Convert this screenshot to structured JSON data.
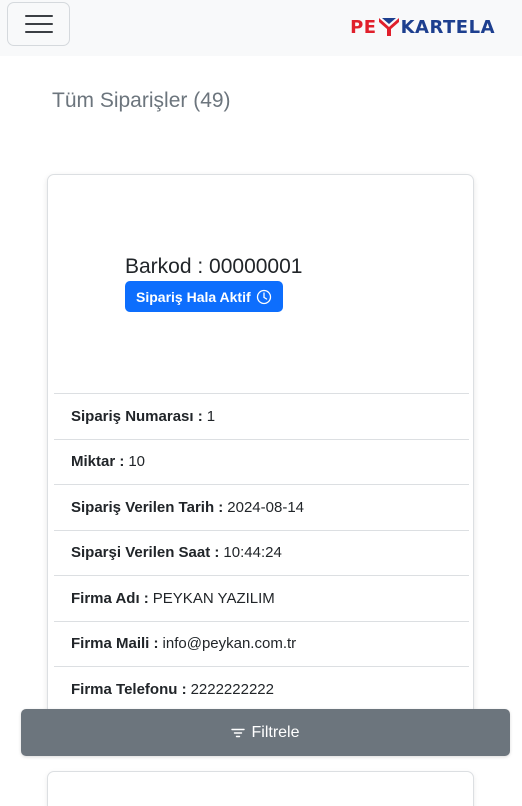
{
  "navbar": {
    "menu_icon": "hamburger-menu-icon",
    "logo_text_left": "PE",
    "logo_text_right": "KARTELA",
    "logo_colors": {
      "red": "#e01f2b",
      "blue": "#1d3f8f"
    }
  },
  "page": {
    "title": "Tüm Siparişler (49)"
  },
  "order_card": {
    "barcode_text": "Barkod : 00000001",
    "status_label": "Sipariş Hala Aktif",
    "status_icon": "clock-icon",
    "status_color": "#0d6efd",
    "fields": [
      {
        "label": "Sipariş Numarası :",
        "value": "1"
      },
      {
        "label": "Miktar :",
        "value": "10"
      },
      {
        "label": "Sipariş Verilen Tarih :",
        "value": "2024-08-14"
      },
      {
        "label": "Siparşi Verilen Saat :",
        "value": "10:44:24"
      },
      {
        "label": "Firma Adı :",
        "value": "PEYKAN YAZILIM"
      },
      {
        "label": "Firma Maili :",
        "value": "info@peykan.com.tr"
      },
      {
        "label": "Firma Telefonu :",
        "value": "2222222222"
      }
    ]
  },
  "filter_button": {
    "label": "Filtrele",
    "icon": "filter-icon",
    "color": "#6c757d"
  }
}
